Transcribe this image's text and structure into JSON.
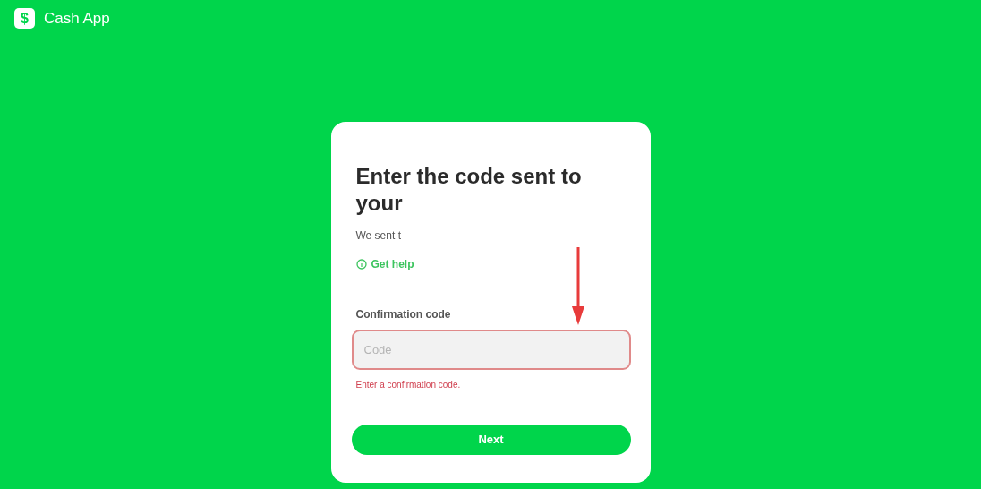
{
  "header": {
    "logo_glyph": "$",
    "brand": "Cash App"
  },
  "card": {
    "title": "Enter the code sent to your",
    "subtitle": "We sent t",
    "help_link": "Get help",
    "field": {
      "label": "Confirmation code",
      "placeholder": "Code",
      "invalid": true,
      "error": "Enter a confirmation code."
    },
    "button": "Next"
  },
  "annotation": {
    "kind": "arrow"
  }
}
